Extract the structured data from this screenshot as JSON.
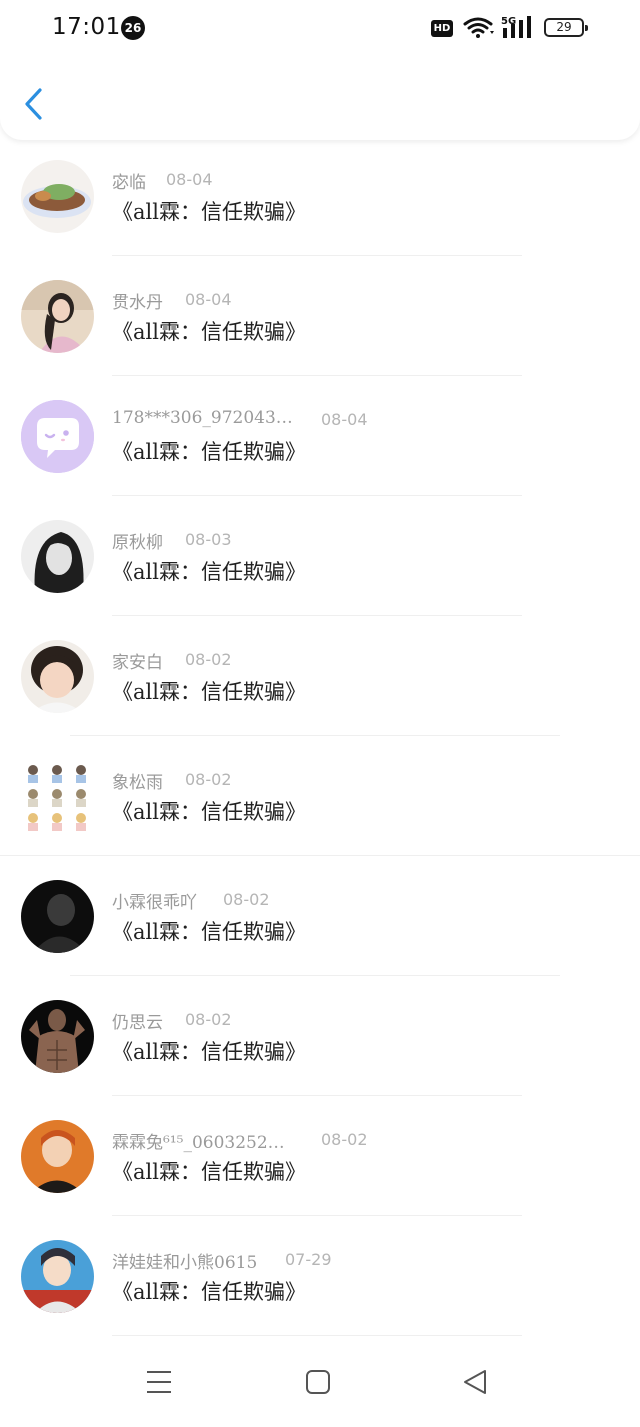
{
  "status": {
    "time": "17:01",
    "notification_count": "26",
    "hd_label": "HD",
    "network": "5G",
    "battery": "29"
  },
  "header": {
    "back_icon": "chevron-left-icon"
  },
  "items": [
    {
      "name": "宓临",
      "date": "08-04",
      "title": "《all霖：信任欺骗》"
    },
    {
      "name": "贯水丹",
      "date": "08-04",
      "title": "《all霖：信任欺骗》"
    },
    {
      "name": "178***306_972043…",
      "date": "08-04",
      "title": "《all霖：信任欺骗》"
    },
    {
      "name": "原秋柳",
      "date": "08-03",
      "title": "《all霖：信任欺骗》"
    },
    {
      "name": "家安白",
      "date": "08-02",
      "title": "《all霖：信任欺骗》"
    },
    {
      "name": "象松雨",
      "date": "08-02",
      "title": "《all霖：信任欺骗》"
    },
    {
      "name": "小霖很乖吖",
      "date": "08-02",
      "title": "《all霖：信任欺骗》"
    },
    {
      "name": "仍思云",
      "date": "08-02",
      "title": "《all霖：信任欺骗》"
    },
    {
      "name": "霖霖兔⁶¹⁵_0603252…",
      "date": "08-02",
      "title": "《all霖：信任欺骗》"
    },
    {
      "name": "洋娃娃和小熊0615",
      "date": "07-29",
      "title": "《all霖：信任欺骗》"
    }
  ],
  "colors": {
    "accent": "#2b8fe0",
    "default_avatar": "#d9c8f5"
  },
  "navbar": {
    "icons": [
      "menu-icon",
      "home-square-icon",
      "back-triangle-icon"
    ]
  }
}
